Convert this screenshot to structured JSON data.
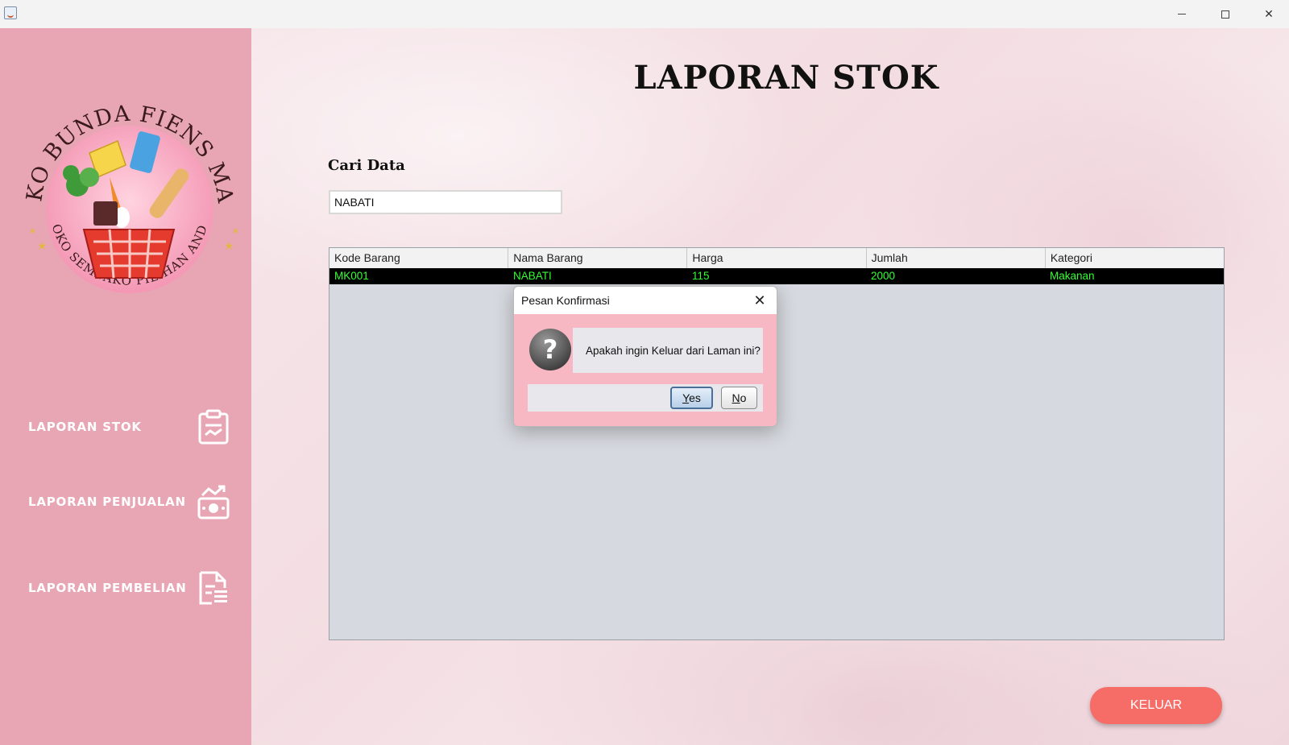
{
  "window": {
    "minimize_glyph": "—",
    "close_glyph": "✕"
  },
  "sidebar": {
    "logo": {
      "arc_top": "TOKO BUNDA FIENS MART",
      "arc_bottom": "TOKO SEMBAKO PILIHAN ANDA"
    },
    "items": [
      {
        "label": "LAPORAN STOK",
        "icon": "clipboard-icon"
      },
      {
        "label": "LAPORAN PENJUALAN",
        "icon": "money-chart-icon"
      },
      {
        "label": "LAPORAN PEMBELIAN",
        "icon": "document-list-icon"
      }
    ]
  },
  "main": {
    "title": "LAPORAN STOK",
    "search_label": "Cari Data",
    "search_value": "NABATI",
    "table": {
      "columns": [
        "Kode Barang",
        "Nama Barang",
        "Harga",
        "Jumlah",
        "Kategori"
      ],
      "rows": [
        [
          "MK001",
          "NABATI",
          "115",
          "2000",
          "Makanan"
        ]
      ]
    },
    "keluar_label": "KELUAR"
  },
  "dialog": {
    "title": "Pesan Konfirmasi",
    "close_glyph": "✕",
    "message": "Apakah ingin Keluar dari Laman ini?",
    "yes_mnemonic": "Y",
    "yes_rest": "es",
    "no_mnemonic": "N",
    "no_rest": "o",
    "icon": "question-icon"
  },
  "colors": {
    "sidebar_bg": "#e8a5b3",
    "keluar_bg": "#f66c66",
    "row_selected_bg": "#000000",
    "row_selected_text": "#33ff33",
    "dialog_bg": "#f7b8c4"
  }
}
